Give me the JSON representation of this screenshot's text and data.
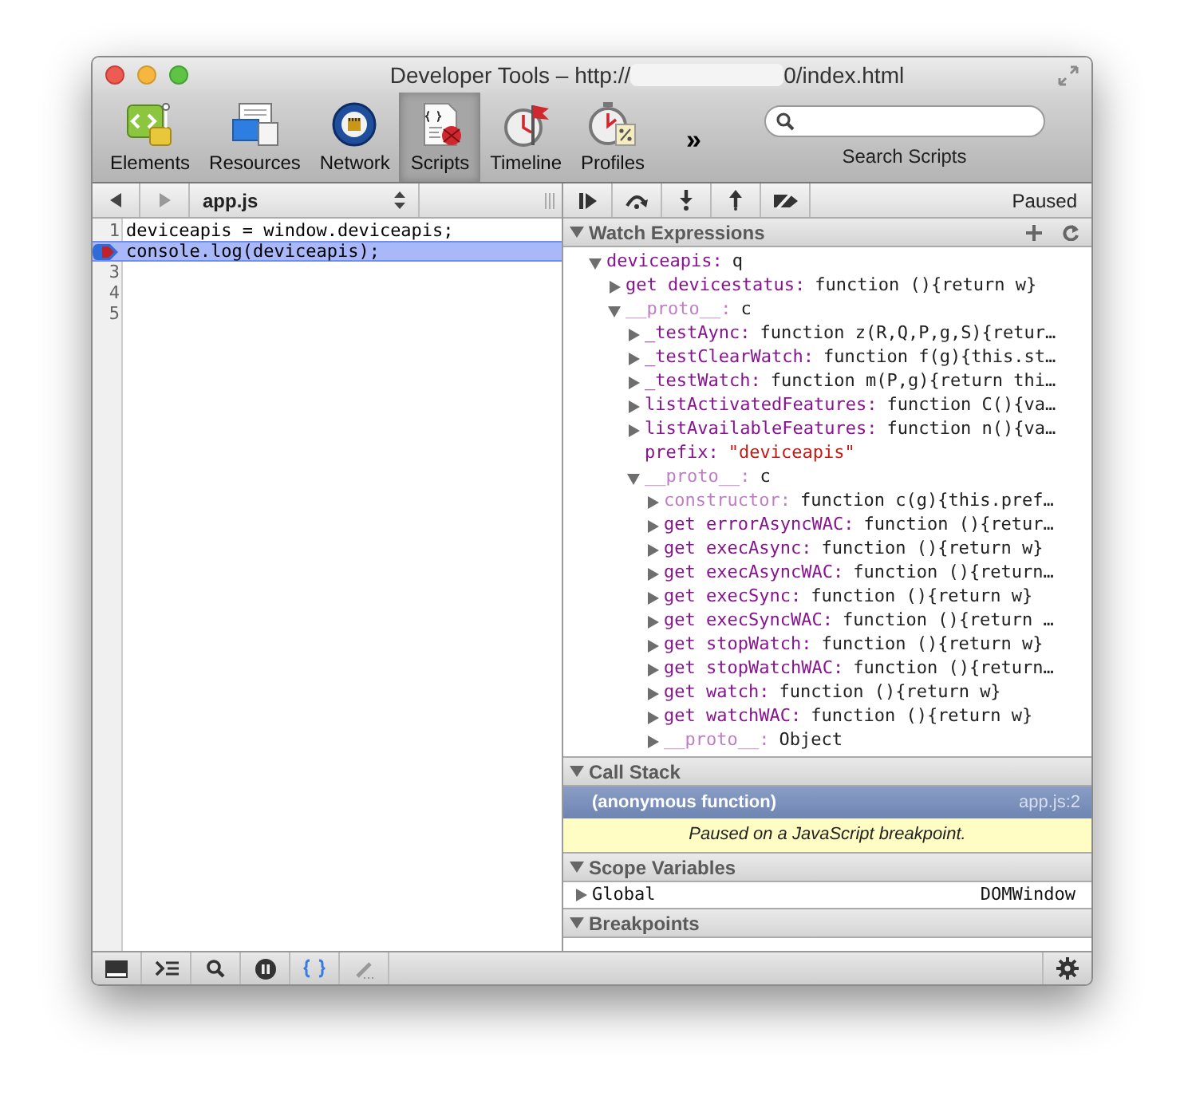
{
  "window": {
    "title_prefix": "Developer Tools – http://",
    "title_suffix": "0/index.html"
  },
  "toolbar": {
    "panels": [
      {
        "label": "Elements",
        "selected": false
      },
      {
        "label": "Resources",
        "selected": false
      },
      {
        "label": "Network",
        "selected": false
      },
      {
        "label": "Scripts",
        "selected": true
      },
      {
        "label": "Timeline",
        "selected": false
      },
      {
        "label": "Profiles",
        "selected": false
      }
    ],
    "overflow": "»",
    "search": {
      "caption": "Search Scripts"
    }
  },
  "editor": {
    "file": "app.js",
    "lines": [
      {
        "number": "1",
        "code": "deviceapis = window.deviceapis;",
        "breakpoint": false,
        "current": false
      },
      {
        "code": "console.log(deviceapis);",
        "breakpoint": true,
        "current": true
      },
      {
        "number": "3",
        "breakpoint": false,
        "current": false
      },
      {
        "number": "4",
        "breakpoint": false,
        "current": false
      },
      {
        "number": "5",
        "breakpoint": false,
        "current": false
      }
    ]
  },
  "debugger": {
    "status": "Paused",
    "watch": {
      "title": "Watch Expressions",
      "expanded": true,
      "tree": [
        {
          "name": "deviceapis:",
          "value": "q",
          "kind": "object",
          "expanded": true,
          "dimmed": false,
          "children": [
            {
              "name": "get devicestatus:",
              "value": "function (){return w}",
              "kind": "object",
              "expanded": false,
              "dimmed": false
            },
            {
              "name": "__proto__:",
              "value": "c",
              "kind": "object",
              "expanded": true,
              "dimmed": true,
              "children": [
                {
                  "name": "_testAync:",
                  "value": "function z(R,Q,P,g,S){retur…",
                  "kind": "object",
                  "expanded": false,
                  "dimmed": false
                },
                {
                  "name": "_testClearWatch:",
                  "value": "function f(g){this.st…",
                  "kind": "object",
                  "expanded": false,
                  "dimmed": false
                },
                {
                  "name": "_testWatch:",
                  "value": "function m(P,g){return thi…",
                  "kind": "object",
                  "expanded": false,
                  "dimmed": false
                },
                {
                  "name": "listActivatedFeatures:",
                  "value": "function C(){va…",
                  "kind": "object",
                  "expanded": false,
                  "dimmed": false
                },
                {
                  "name": "listAvailableFeatures:",
                  "value": "function n(){va…",
                  "kind": "object",
                  "expanded": false,
                  "dimmed": false
                },
                {
                  "name": "prefix:",
                  "value": "\"deviceapis\"",
                  "kind": "string",
                  "dimmed": false
                },
                {
                  "name": "__proto__:",
                  "value": "c",
                  "kind": "object",
                  "expanded": true,
                  "dimmed": true,
                  "children": [
                    {
                      "name": "constructor:",
                      "value": "function c(g){this.pref…",
                      "kind": "object",
                      "expanded": false,
                      "dimmed": true
                    },
                    {
                      "name": "get errorAsyncWAC:",
                      "value": "function (){retur…",
                      "kind": "object",
                      "expanded": false,
                      "dimmed": false
                    },
                    {
                      "name": "get execAsync:",
                      "value": "function (){return w}",
                      "kind": "object",
                      "expanded": false,
                      "dimmed": false
                    },
                    {
                      "name": "get execAsyncWAC:",
                      "value": "function (){return…",
                      "kind": "object",
                      "expanded": false,
                      "dimmed": false
                    },
                    {
                      "name": "get execSync:",
                      "value": "function (){return w}",
                      "kind": "object",
                      "expanded": false,
                      "dimmed": false
                    },
                    {
                      "name": "get execSyncWAC:",
                      "value": "function (){return …",
                      "kind": "object",
                      "expanded": false,
                      "dimmed": false
                    },
                    {
                      "name": "get stopWatch:",
                      "value": "function (){return w}",
                      "kind": "object",
                      "expanded": false,
                      "dimmed": false
                    },
                    {
                      "name": "get stopWatchWAC:",
                      "value": "function (){return…",
                      "kind": "object",
                      "expanded": false,
                      "dimmed": false
                    },
                    {
                      "name": "get watch:",
                      "value": "function (){return w}",
                      "kind": "object",
                      "expanded": false,
                      "dimmed": false
                    },
                    {
                      "name": "get watchWAC:",
                      "value": "function (){return w}",
                      "kind": "object",
                      "expanded": false,
                      "dimmed": false
                    },
                    {
                      "name": "__proto__:",
                      "value": "Object",
                      "kind": "object",
                      "expanded": false,
                      "dimmed": true
                    }
                  ]
                }
              ]
            }
          ]
        }
      ]
    },
    "call_stack": {
      "title": "Call Stack",
      "expanded": true,
      "frames": [
        {
          "name": "(anonymous function)",
          "location": "app.js:2",
          "selected": true
        }
      ],
      "message": "Paused on a JavaScript breakpoint."
    },
    "scope": {
      "title": "Scope Variables",
      "expanded": true,
      "items": [
        {
          "name": "Global",
          "value": "DOMWindow",
          "expanded": false
        }
      ]
    },
    "breakpoints": {
      "title": "Breakpoints",
      "expanded": true
    }
  }
}
